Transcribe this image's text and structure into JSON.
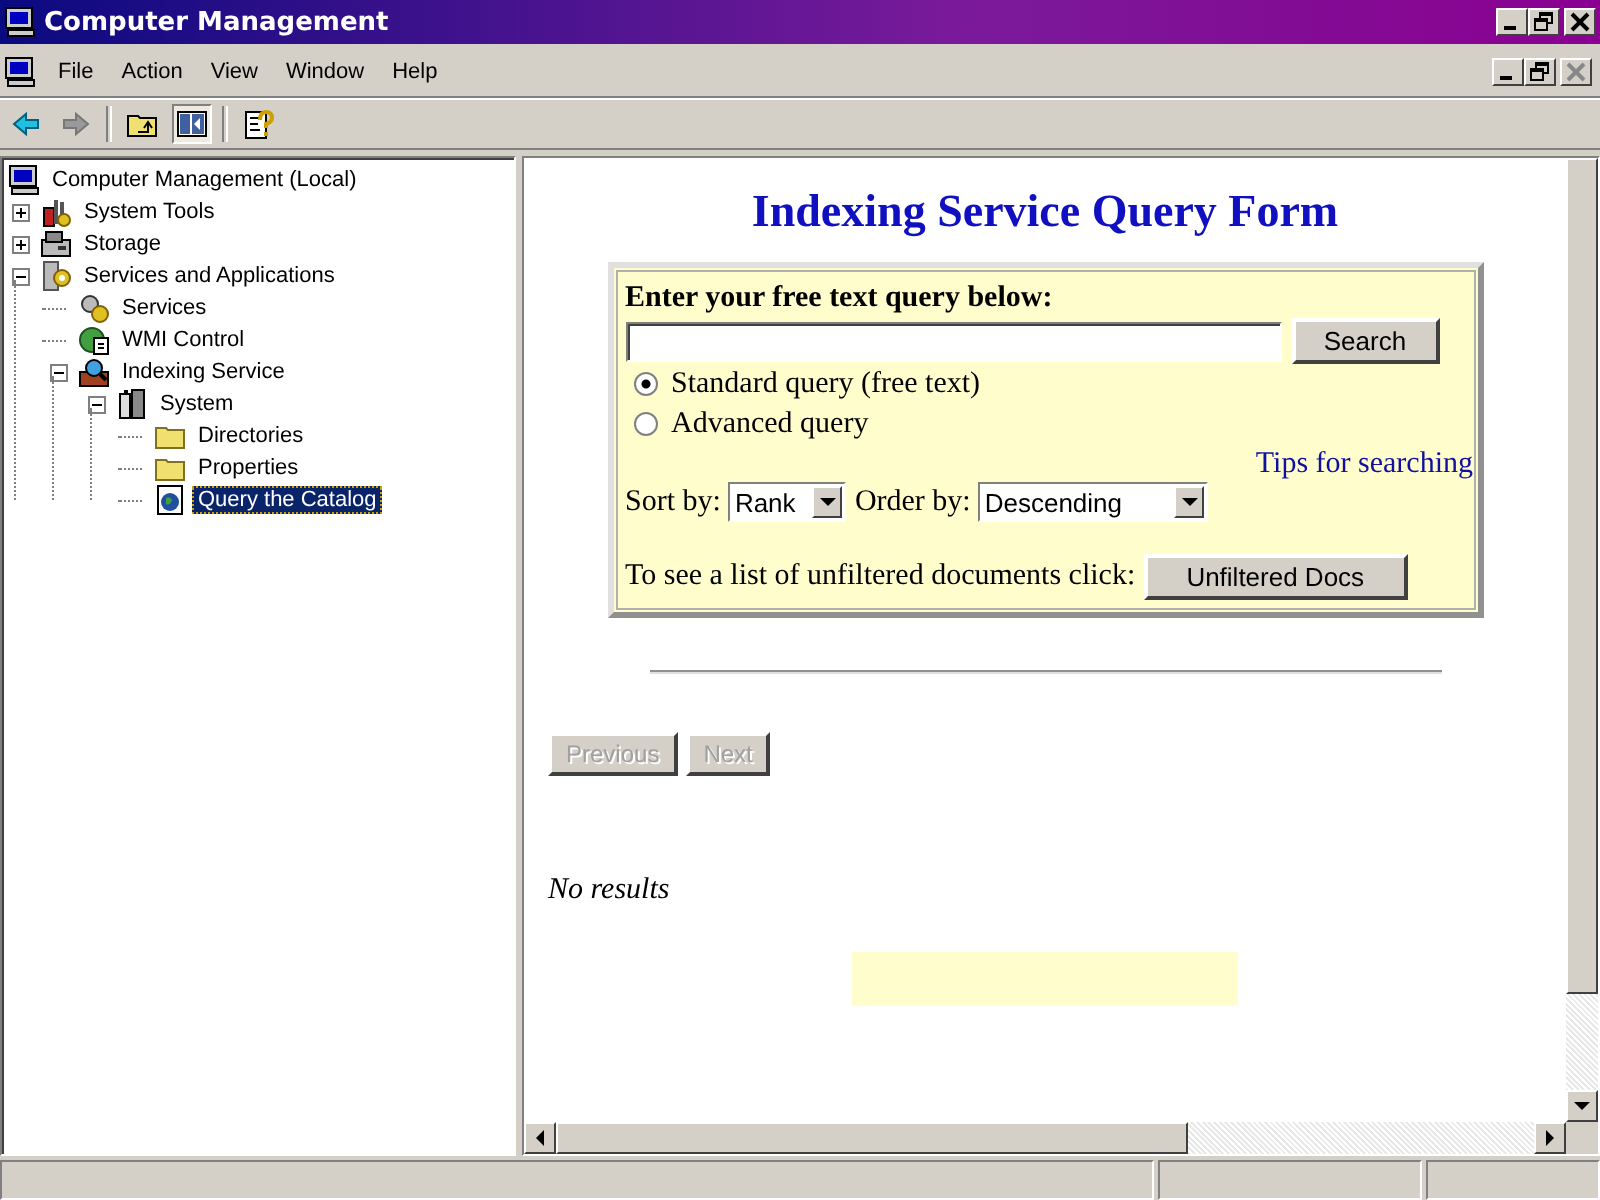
{
  "window": {
    "title": "Computer Management"
  },
  "menu": [
    "File",
    "Action",
    "View",
    "Window",
    "Help"
  ],
  "tree": [
    {
      "label": "Computer Management (Local)",
      "kind": "computer",
      "selected": false,
      "children": [
        {
          "label": "System Tools",
          "kind": "tools",
          "expanded": false,
          "selected": false
        },
        {
          "label": "Storage",
          "kind": "storage",
          "expanded": false,
          "selected": false
        },
        {
          "label": "Services and Applications",
          "kind": "services-apps",
          "expanded": true,
          "selected": false,
          "children": [
            {
              "label": "Services",
              "kind": "services",
              "selected": false
            },
            {
              "label": "WMI Control",
              "kind": "wmi",
              "selected": false
            },
            {
              "label": "Indexing Service",
              "kind": "indexing",
              "expanded": true,
              "selected": false,
              "children": [
                {
                  "label": "System",
                  "kind": "catalog",
                  "expanded": true,
                  "selected": false,
                  "children": [
                    {
                      "label": "Directories",
                      "kind": "folder",
                      "selected": false
                    },
                    {
                      "label": "Properties",
                      "kind": "folder",
                      "selected": false
                    },
                    {
                      "label": "Query the Catalog",
                      "kind": "query",
                      "selected": true
                    }
                  ]
                }
              ]
            }
          ]
        }
      ]
    }
  ],
  "page": {
    "heading": "Indexing Service Query Form",
    "form": {
      "label": "Enter your free text query below:",
      "search_button": "Search",
      "radios": [
        {
          "label": "Standard query (free text)",
          "selected": true
        },
        {
          "label": "Advanced query",
          "selected": false
        }
      ],
      "tips_link": "Tips for searching",
      "sort_label": "Sort by:",
      "sort_value": "Rank",
      "order_label": "Order by:",
      "order_value": "Descending",
      "unfiltered_text": "To see a list of unfiltered documents click:",
      "unfiltered_button": "Unfiltered Docs"
    },
    "nav_buttons": [
      {
        "label": "Previous",
        "disabled": true
      },
      {
        "label": "Next",
        "disabled": true
      }
    ],
    "result_text": "No results"
  }
}
